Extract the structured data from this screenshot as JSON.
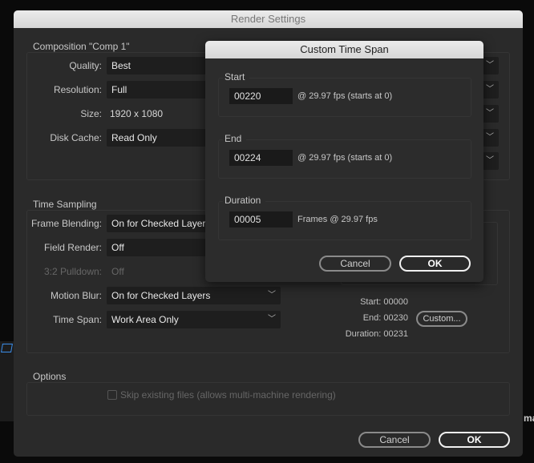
{
  "render_settings": {
    "title": "Render Settings",
    "composition": {
      "label": "Composition \"Comp 1\"",
      "quality": {
        "label": "Quality:",
        "value": "Best"
      },
      "resolution": {
        "label": "Resolution:",
        "value": "Full"
      },
      "size": {
        "label": "Size:",
        "value": "1920 x 1080"
      },
      "disk_cache": {
        "label": "Disk Cache:",
        "value": "Read Only"
      }
    },
    "time_sampling": {
      "label": "Time Sampling",
      "frame_blending": {
        "label": "Frame Blending:",
        "value": "On for Checked Layers"
      },
      "field_render": {
        "label": "Field Render:",
        "value": "Off"
      },
      "pulldown": {
        "label": "3:2 Pulldown:",
        "value": "Off"
      },
      "motion_blur": {
        "label": "Motion Blur:",
        "value": "On for Checked Layers"
      },
      "time_span": {
        "label": "Time Span:",
        "value": "Work Area Only"
      },
      "start": "Start: 00000",
      "end": "End: 00230",
      "duration": "Duration: 00231",
      "custom_button": "Custom..."
    },
    "options": {
      "label": "Options",
      "skip_files": {
        "label": "Skip existing files (allows multi-machine rendering)",
        "checked": false
      }
    },
    "cancel": "Cancel",
    "ok": "OK"
  },
  "custom_time_span": {
    "title": "Custom Time Span",
    "start": {
      "label": "Start",
      "value": "00220",
      "note": "@ 29.97 fps (starts at 0)"
    },
    "end": {
      "label": "End",
      "value": "00224",
      "note": "@ 29.97 fps (starts at 0)"
    },
    "duration": {
      "label": "Duration",
      "value": "00005",
      "note": "Frames @ 29.97 fps"
    },
    "cancel": "Cancel",
    "ok": "OK"
  },
  "background": {
    "partial_text": "ma"
  }
}
